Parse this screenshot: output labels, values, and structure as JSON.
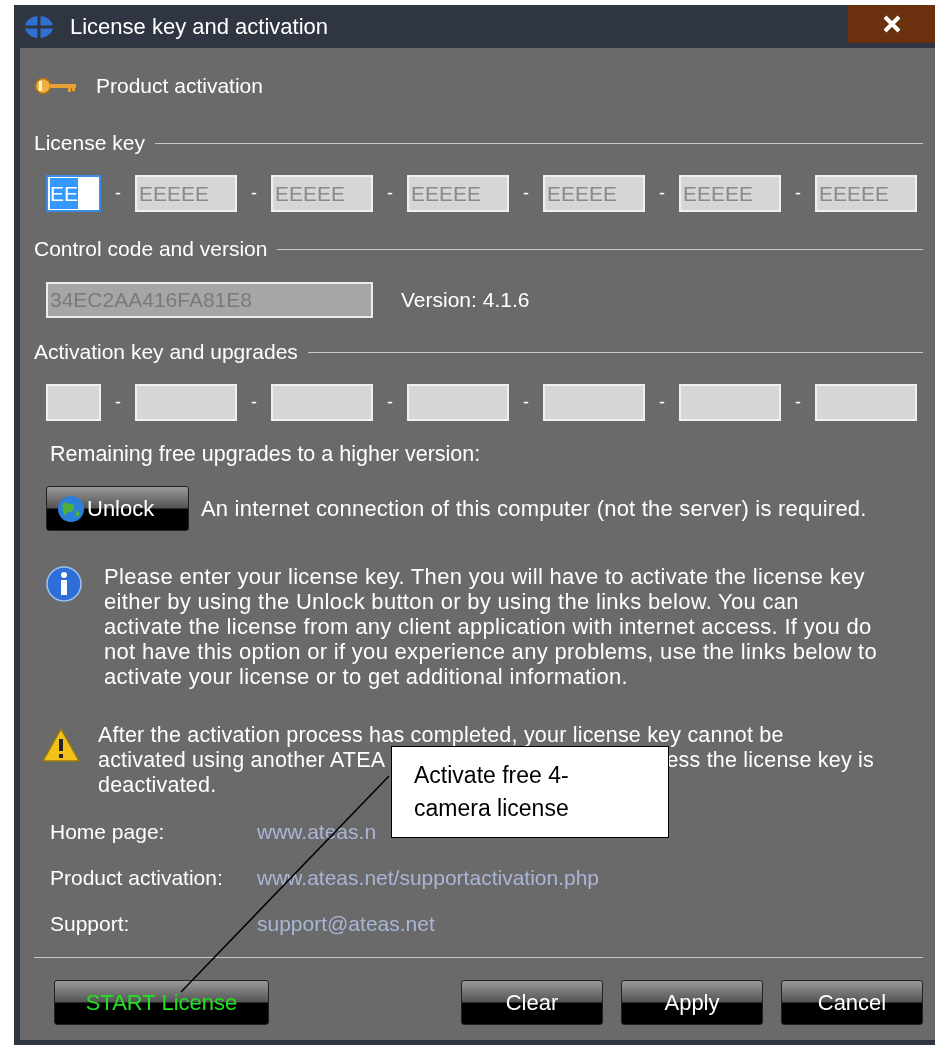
{
  "window": {
    "title": "License key and activation"
  },
  "header": "Product activation",
  "license_key": {
    "label": "License key",
    "segments": [
      {
        "value": "EE",
        "focused": true
      },
      {
        "value": "EEEEE",
        "focused": false,
        "separator": "-"
      },
      {
        "value": "EEEEE",
        "focused": false,
        "separator": "-"
      },
      {
        "value": "EEEEE",
        "focused": false,
        "separator": "-"
      },
      {
        "value": "EEEEE",
        "focused": false,
        "separator": "-"
      },
      {
        "value": "EEEEE",
        "focused": false,
        "separator": "-"
      },
      {
        "value": "EEEEE",
        "focused": false,
        "separator": "-"
      }
    ]
  },
  "control": {
    "label": "Control code and version",
    "code": "34EC2AA416FA81E8",
    "version": "Version: 4.1.6"
  },
  "activation": {
    "label": "Activation key and upgrades",
    "segments": [
      {
        "kind": "field"
      },
      {
        "kind": "field",
        "separator": "-"
      },
      {
        "kind": "field",
        "separator": "-"
      },
      {
        "kind": "field",
        "separator": "-"
      },
      {
        "kind": "field",
        "separator": "-"
      },
      {
        "kind": "field",
        "separator": "-"
      },
      {
        "kind": "field",
        "separator": "-"
      }
    ],
    "upgrades_note": "Remaining free upgrades to a higher version:"
  },
  "unlock": {
    "label": "Unlock",
    "note": "An internet connection of this computer (not the server) is required."
  },
  "info": "Please enter your license key. Then you will have to activate the license key either by using the Unlock button or by using the links below. You can activate the license from any client application with internet access. If you do not have this option or if you experience any problems, use the links below to activate your license or to get additional information.",
  "warning": {
    "lines": [
      "After the activation process has completed, your license key cannot be",
      "activated using another ATEA",
      "ess the license key is",
      "deactivated."
    ]
  },
  "links": [
    {
      "label": "Home page:",
      "value": "www.ateas.n"
    },
    {
      "label": "Product activation:",
      "value": "www.ateas.net/supportactivation.php"
    },
    {
      "label": "Support:",
      "value": "support@ateas.net"
    }
  ],
  "buttons": [
    {
      "label": "START License",
      "kind": "start"
    },
    {
      "label": "Clear",
      "kind": "normal"
    },
    {
      "label": "Apply",
      "kind": "normal"
    },
    {
      "label": "Cancel",
      "kind": "normal"
    }
  ],
  "callout": {
    "text": "Activate free 4-camera license"
  }
}
